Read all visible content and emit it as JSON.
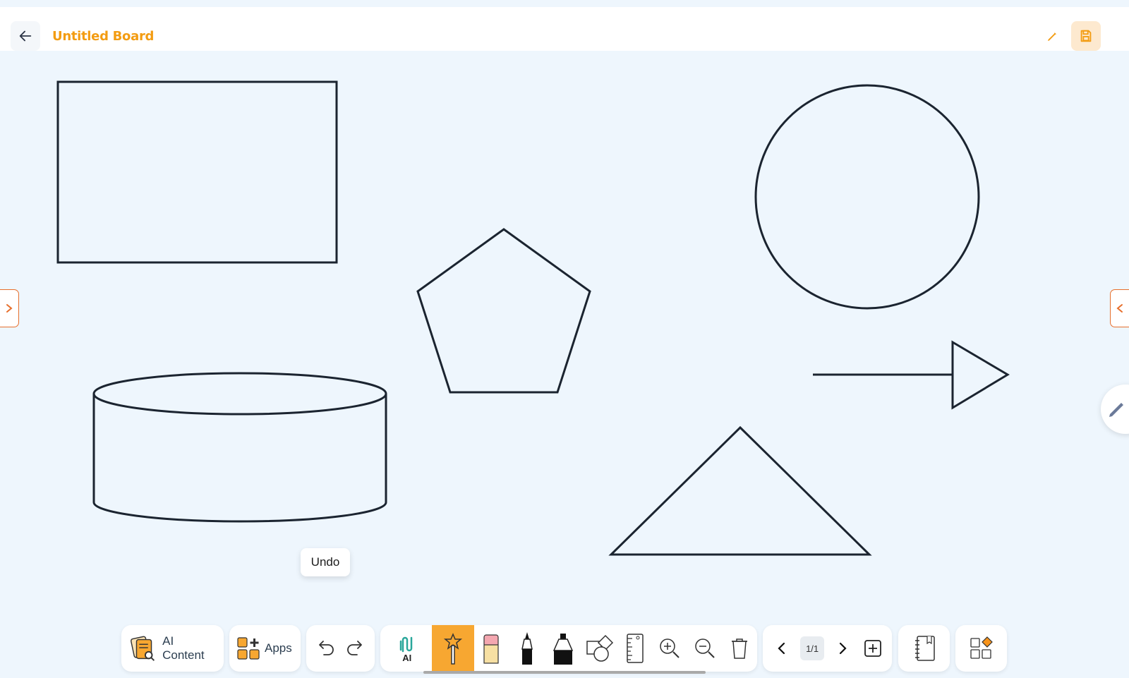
{
  "header": {
    "title": "Untitled Board"
  },
  "tooltip": {
    "text": "Undo"
  },
  "toolbar": {
    "ai_content_label": "AI Content",
    "apps_label": "Apps",
    "ai_tool_label": "AI",
    "page_indicator": "1/1"
  },
  "colors": {
    "accent": "#f39c12",
    "active_tool_bg": "#f7a731",
    "side_tab_border": "#e76f2c",
    "canvas_bg": "#eef6fd",
    "shape_stroke": "#1b2430"
  },
  "icons": [
    "back-arrow-icon",
    "pencil-icon",
    "save-icon",
    "chevron-right-icon",
    "chevron-left-icon",
    "ai-content-icon",
    "apps-icon",
    "undo-icon",
    "redo-icon",
    "ai-pen-icon",
    "magic-wand-icon",
    "eraser-icon",
    "marker-icon",
    "highlighter-icon",
    "shapes-icon",
    "ruler-icon",
    "zoom-in-icon",
    "zoom-out-icon",
    "trash-icon",
    "prev-page-icon",
    "next-page-icon",
    "add-page-icon",
    "notebook-icon",
    "widgets-icon"
  ]
}
